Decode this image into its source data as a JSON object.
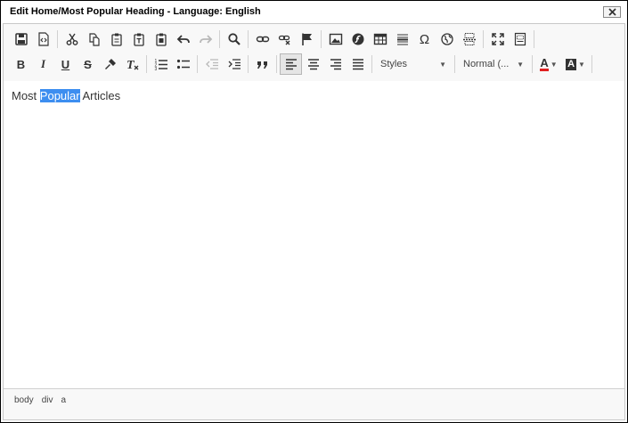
{
  "window": {
    "title": "Edit Home/Most Popular Heading - Language: English"
  },
  "toolbar": {
    "row1": [
      {
        "name": "save-icon"
      },
      {
        "name": "source-icon"
      },
      {
        "sep": true
      },
      {
        "name": "cut-icon"
      },
      {
        "name": "copy-icon"
      },
      {
        "name": "paste-icon"
      },
      {
        "name": "paste-text-icon"
      },
      {
        "name": "paste-word-icon"
      },
      {
        "name": "undo-icon"
      },
      {
        "name": "redo-icon",
        "disabled": true
      },
      {
        "sep": true
      },
      {
        "name": "find-icon"
      },
      {
        "sep": true
      },
      {
        "name": "link-icon"
      },
      {
        "name": "unlink-icon"
      },
      {
        "name": "anchor-icon"
      },
      {
        "sep": true
      },
      {
        "name": "image-icon"
      },
      {
        "name": "flash-icon"
      },
      {
        "name": "table-icon"
      },
      {
        "name": "horizontal-rule-icon"
      },
      {
        "name": "special-char-icon"
      },
      {
        "name": "iframe-icon"
      },
      {
        "name": "page-break-icon"
      },
      {
        "sep": true
      },
      {
        "name": "maximize-icon"
      },
      {
        "name": "show-blocks-icon"
      },
      {
        "sep": true
      }
    ],
    "row2": [
      {
        "name": "bold-icon"
      },
      {
        "name": "italic-icon"
      },
      {
        "name": "underline-icon"
      },
      {
        "name": "strikethrough-icon"
      },
      {
        "name": "copy-format-icon"
      },
      {
        "name": "remove-format-icon"
      },
      {
        "sep": true
      },
      {
        "name": "numbered-list-icon"
      },
      {
        "name": "bulleted-list-icon"
      },
      {
        "sep": true
      },
      {
        "name": "outdent-icon",
        "disabled": true
      },
      {
        "name": "indent-icon"
      },
      {
        "sep": true
      },
      {
        "name": "blockquote-icon"
      },
      {
        "sep": true
      },
      {
        "name": "align-left-icon",
        "active": true
      },
      {
        "name": "align-center-icon"
      },
      {
        "name": "align-right-icon"
      },
      {
        "name": "justify-icon"
      },
      {
        "sep": true
      }
    ],
    "styles_label": "Styles",
    "format_label": "Normal (...",
    "text_color_glyph": "A",
    "bg_color_glyph": "A"
  },
  "content": {
    "before": "Most ",
    "selected": "Popular",
    "after": " Articles"
  },
  "statusbar": {
    "crumbs": [
      "body",
      "div",
      "a"
    ]
  },
  "colors": {
    "selection": "#3d8ef0",
    "text_color_underline": "#e02020"
  }
}
